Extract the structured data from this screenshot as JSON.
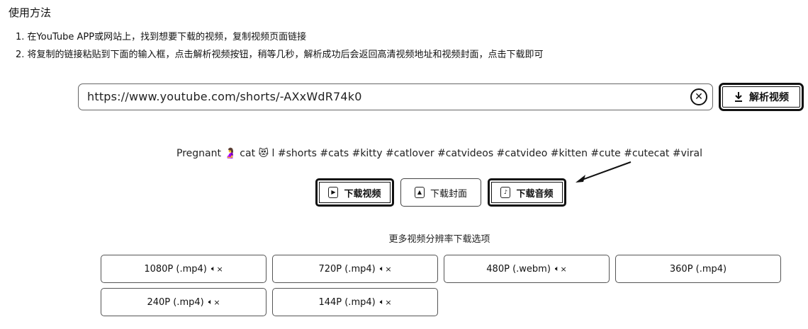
{
  "usage": {
    "title": "使用方法",
    "steps": [
      "1. 在YouTube APP或网站上，找到想要下载的视频，复制视频页面链接",
      "2. 将复制的链接粘贴到下面的输入框，点击解析视频按钮，稍等几秒，解析成功后会返回高清视频地址和视频封面，点击下载即可"
    ]
  },
  "input": {
    "value": "https://www.youtube.com/shorts/-AXxWdR74k0",
    "clear_icon": "close-circle-icon"
  },
  "parse_button": {
    "label": "解析视频",
    "icon": "download-icon"
  },
  "video": {
    "title": "Pregnant 🤰 cat 😻 l #shorts #cats #kitty #catlover #catvideos #catvideo #kitten #cute #cutecat #viral"
  },
  "actions": [
    {
      "label": "下载视频",
      "icon": "video-file-icon"
    },
    {
      "label": "下载封面",
      "icon": "image-file-icon"
    },
    {
      "label": "下载音频",
      "icon": "audio-file-icon"
    }
  ],
  "more": {
    "title": "更多视频分辨率下载选项"
  },
  "resolutions": [
    {
      "label": "1080P (.mp4)",
      "icon": "muted-speaker-icon"
    },
    {
      "label": "720P (.mp4)",
      "icon": "muted-speaker-icon"
    },
    {
      "label": "480P (.webm)",
      "icon": "muted-speaker-icon"
    },
    {
      "label": "360P (.mp4)",
      "icon": ""
    },
    {
      "label": "240P (.mp4)",
      "icon": "muted-speaker-icon"
    },
    {
      "label": "144P (.mp4)",
      "icon": "muted-speaker-icon"
    }
  ]
}
